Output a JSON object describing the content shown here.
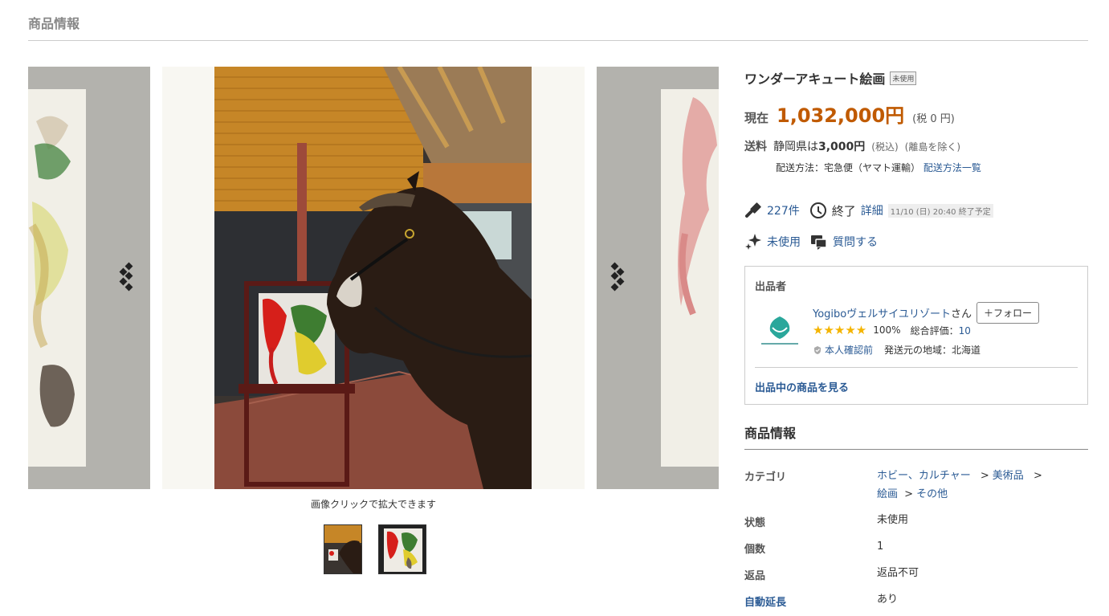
{
  "header": {
    "title": "商品情報"
  },
  "gallery": {
    "caption": "画像クリックで拡大できます",
    "thumbnails": [
      "thumb-horse-painting",
      "thumb-canvas-painting"
    ]
  },
  "product": {
    "title": "ワンダーアキュート絵画",
    "condition_badge": "未使用",
    "price_label": "現在",
    "price": "1,032,000円",
    "tax": "(税 0 円)"
  },
  "shipping": {
    "label": "送料",
    "region": "静岡県は",
    "amount": "3,000円",
    "tax_note": "(税込)",
    "island_note": "(離島を除く)",
    "method_text": "配送方法：宅急便（ヤマト運輸）",
    "method_link": "配送方法一覧"
  },
  "meta": {
    "bids": "227件",
    "status": "終了",
    "detail_link": "詳細",
    "end_date": "11/10 (日) 20:40 終了予定",
    "condition": "未使用",
    "question": "質問する"
  },
  "seller": {
    "heading": "出品者",
    "name": "Yogiboヴェルサイユリゾート",
    "suffix": "さん",
    "follow": "＋フォロー",
    "rating_pct": "100%",
    "total_label": "総合評価：",
    "total_value": "10",
    "verified": "本人確認前",
    "origin": "発送元の地域：北海道",
    "items_link": "出品中の商品を見る",
    "stars": 5
  },
  "details": {
    "title": "商品情報",
    "category_label": "カテゴリ",
    "category_1": "ホビー、カルチャー",
    "category_2": "美術品",
    "category_3": "絵画",
    "category_4": "その他",
    "sep": ">",
    "condition_label": "状態",
    "condition_value": "未使用",
    "count_label": "個数",
    "count_value": "1",
    "return_label": "返品",
    "return_value": "返品不可",
    "auto_ext_label": "自動延長",
    "auto_ext_value": "あり"
  },
  "colors": {
    "price": "#c05a00",
    "link": "#2a5a94",
    "star": "#f4b400"
  }
}
